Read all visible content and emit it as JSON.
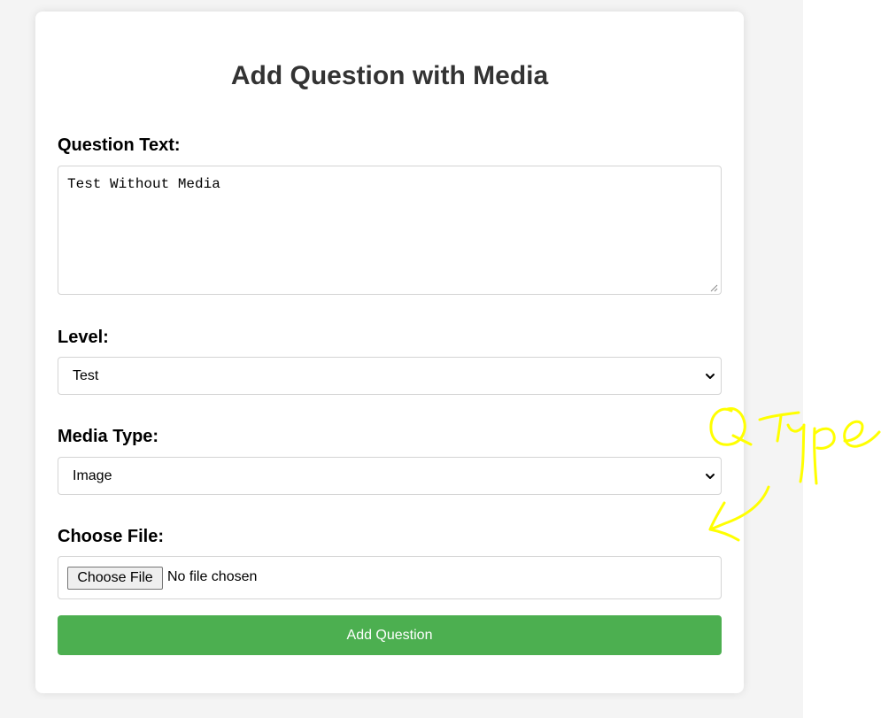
{
  "colors": {
    "page_background": "#f4f4f4",
    "card_background": "#ffffff",
    "title_color": "#333333",
    "accent_button": "#4caf50",
    "annotation_color": "#ffff00"
  },
  "form": {
    "title": "Add Question with Media",
    "question": {
      "label": "Question Text:",
      "value": "Test Without Media"
    },
    "level": {
      "label": "Level:",
      "selected": "Test"
    },
    "media_type": {
      "label": "Media Type:",
      "selected": "Image"
    },
    "file": {
      "label": "Choose File:",
      "button_label": "Choose File",
      "status": "No file chosen"
    },
    "submit_label": "Add Question"
  },
  "annotation": {
    "icon": "handwritten-arrow-icon",
    "text": "Q Type"
  }
}
